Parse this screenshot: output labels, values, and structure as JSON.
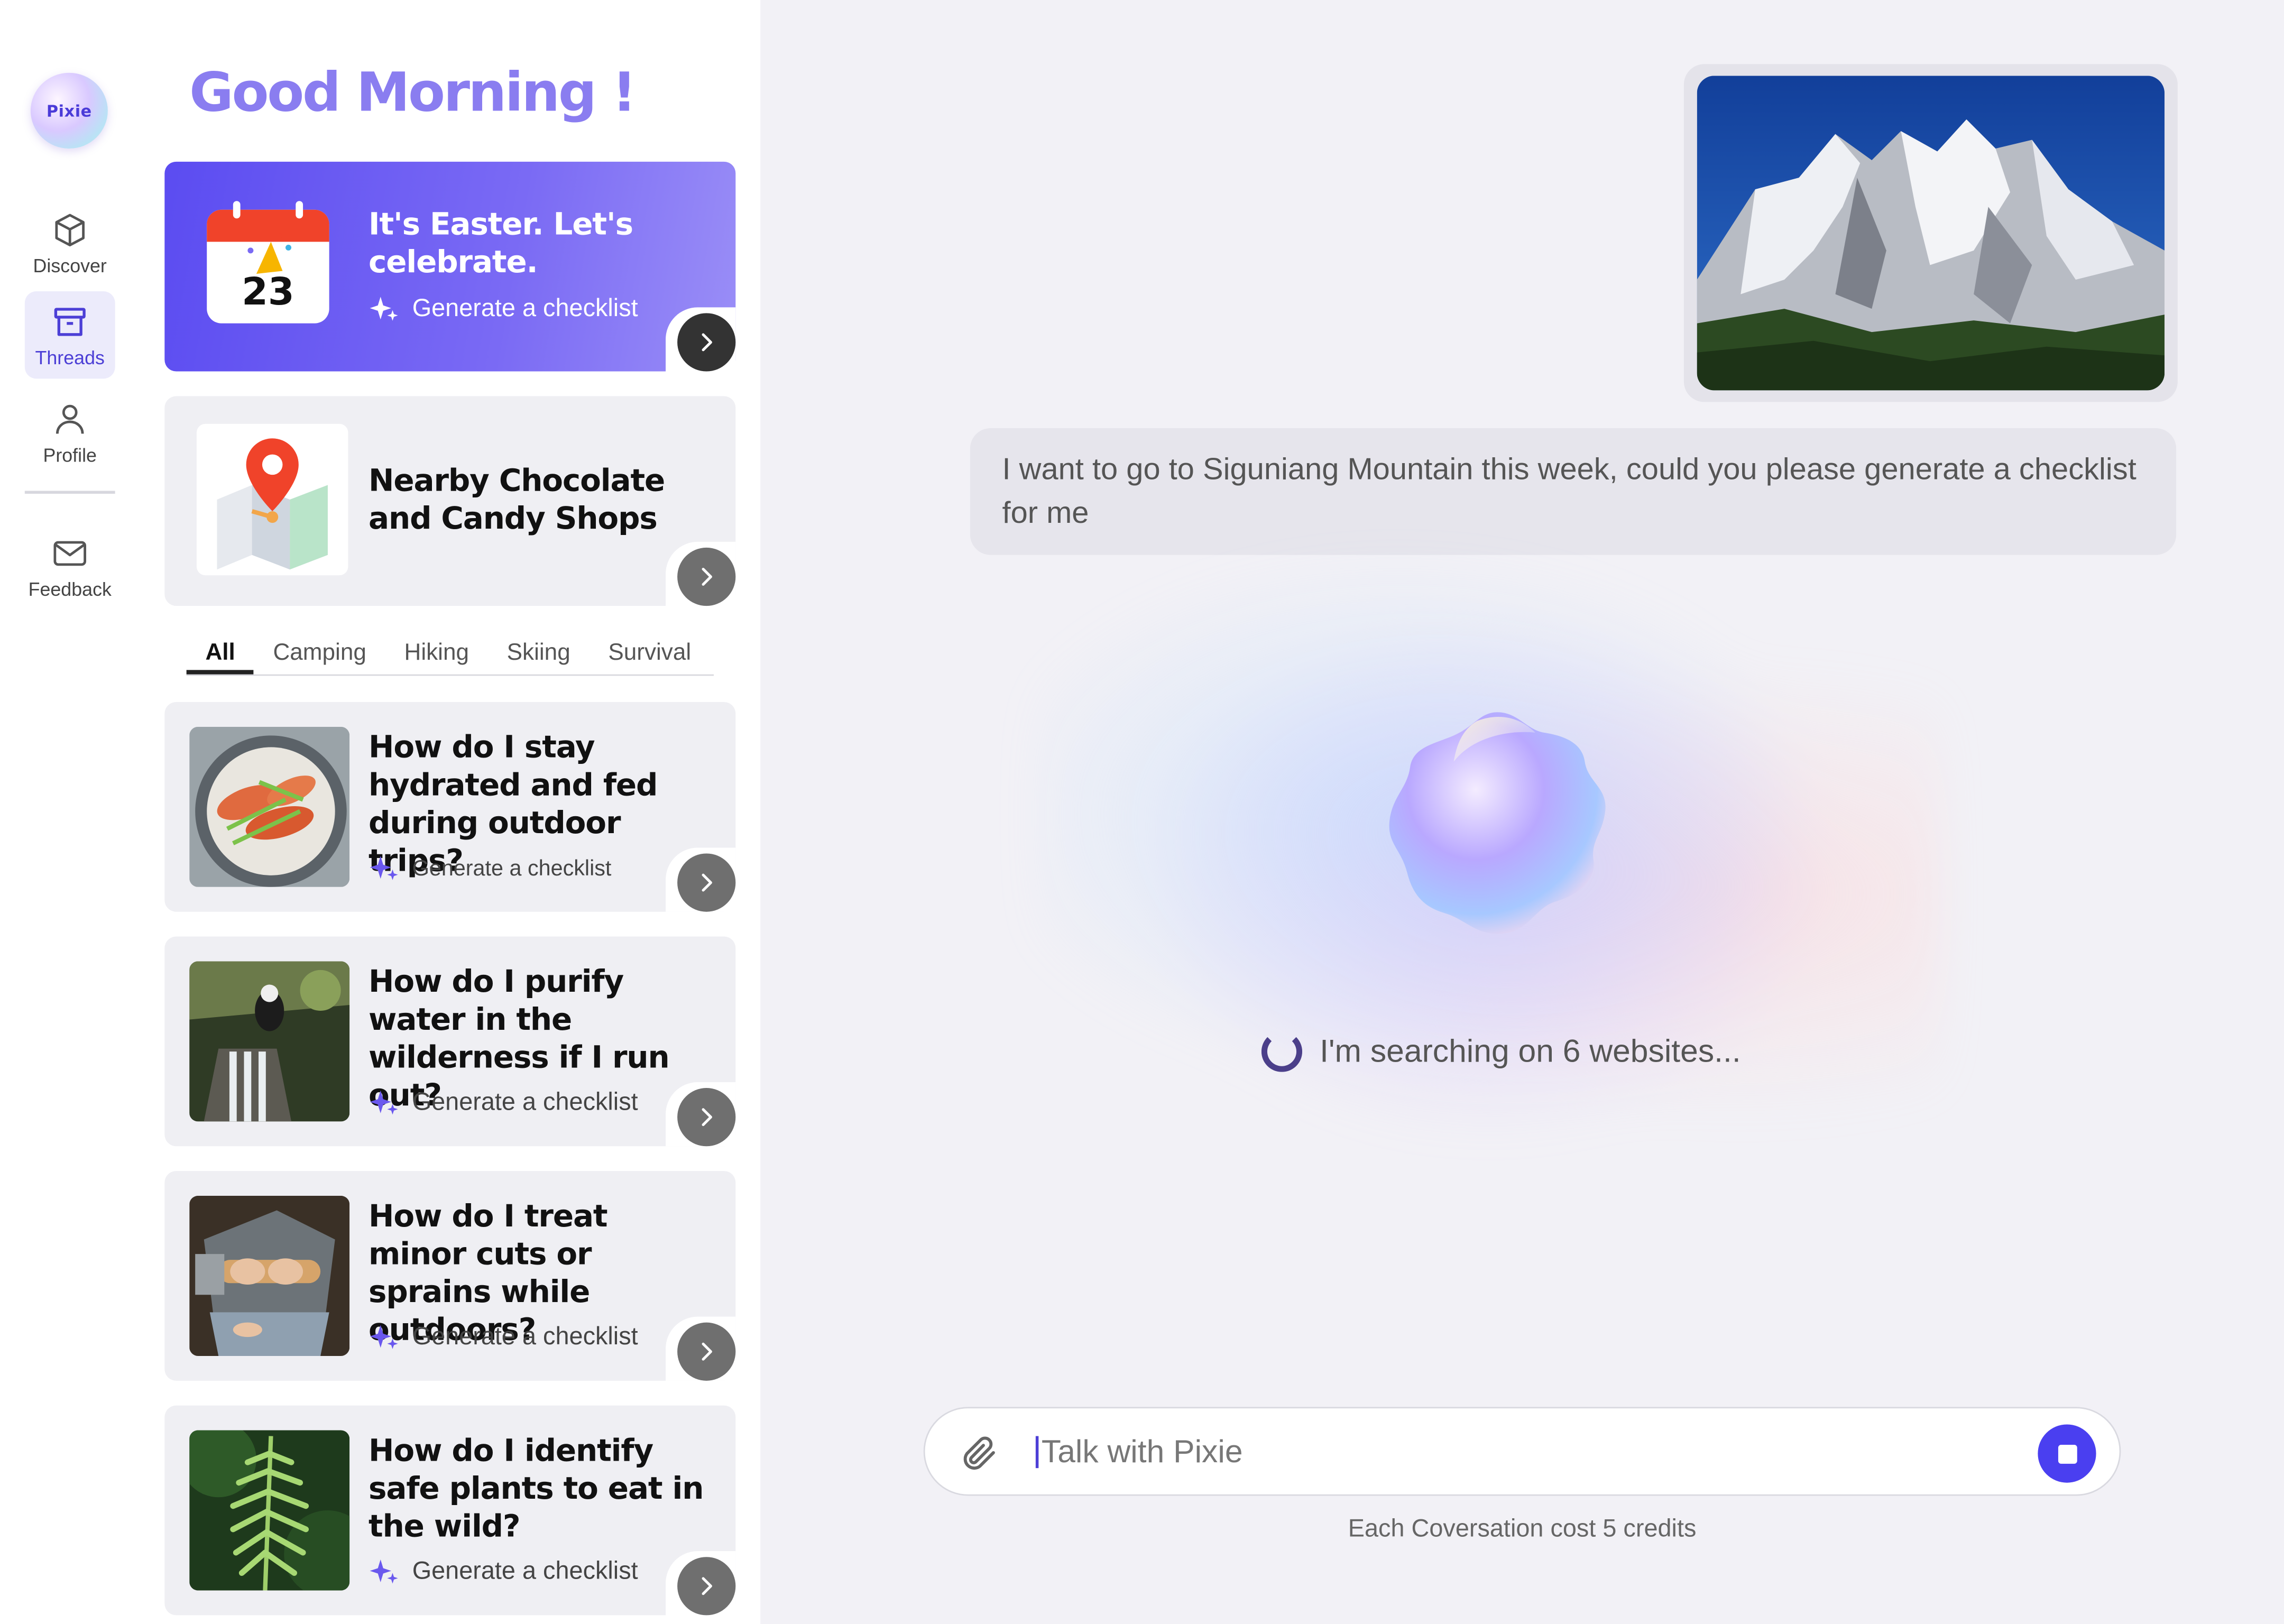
{
  "app": {
    "logo_text": "Pixie"
  },
  "nav": {
    "discover": "Discover",
    "threads": "Threads",
    "profile": "Profile",
    "feedback": "Feedback"
  },
  "greeting": "Good Morning !",
  "hero_card": {
    "title": "It's Easter. Let's celebrate.",
    "calendar_day": "23",
    "action": "Generate a checklist"
  },
  "nearby_card": {
    "title": "Nearby Chocolate and Candy Shops"
  },
  "tabs": [
    "All",
    "Camping",
    "Hiking",
    "Skiing",
    "Survival"
  ],
  "active_tab": "All",
  "topics": [
    {
      "title": "How do I stay hydrated and fed during outdoor trips?",
      "action": "Generate a checklist"
    },
    {
      "title": "How do I purify water in the wilderness if I run out?",
      "action": "Generate a checklist"
    },
    {
      "title": "How do I treat minor cuts or sprains while outdoors?",
      "action": "Generate a checklist"
    },
    {
      "title": "How do I identify safe plants to eat in the wild?",
      "action": "Generate a checklist"
    }
  ],
  "chat": {
    "user_message": "I want to go to Siguniang Mountain this week, could you please generate a checklist for me",
    "status": "I'm searching on 6 websites..."
  },
  "composer": {
    "placeholder": "Talk with Pixie",
    "note": "Each Coversation cost 5 credits"
  },
  "colors": {
    "accent": "#5b4cf1",
    "greeting": "#8a7df0",
    "stop_button": "#4a3ff0"
  }
}
